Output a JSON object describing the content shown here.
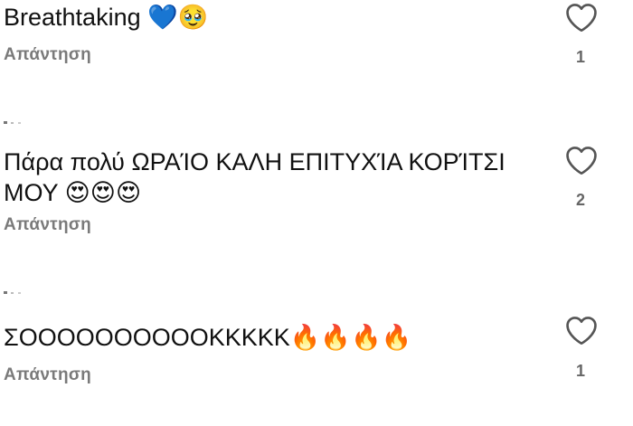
{
  "comments": [
    {
      "text": "Breathtaking 💙🥹",
      "reply_label": "Απάντηση",
      "like_count": "1"
    },
    {
      "text": "Πάρα πολύ ΩΡΑΊΟ ΚΑΛΗ ΕΠΙΤΥΧΊΑ ΚΟΡΊΤΣΙ ΜΟΥ 😍😍😍",
      "reply_label": "Απάντηση",
      "like_count": "2"
    },
    {
      "text": "ΣΟΟΟΟΟΟΟΟΟΟKKKKK🔥🔥🔥🔥",
      "reply_label": "Απάντηση",
      "like_count": "1"
    }
  ],
  "icons": {
    "like": "heart-outline-icon"
  },
  "colors": {
    "text": "#111111",
    "secondary": "#7a7a7a",
    "icon": "#555555"
  }
}
